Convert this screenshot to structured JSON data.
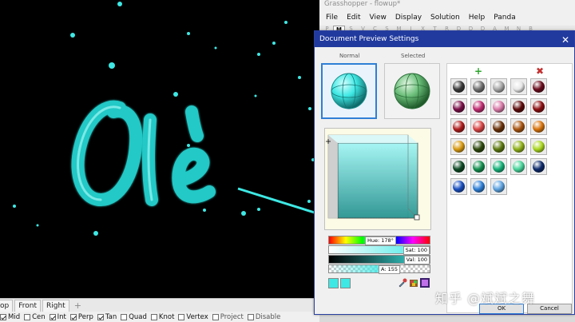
{
  "viewport": {
    "text": "Olé",
    "line_color": "#3ee8e4"
  },
  "view_tabs": {
    "items": [
      "op",
      "Front",
      "Right"
    ],
    "add": "+"
  },
  "osnap": {
    "items": [
      {
        "label": "Mid",
        "checked": true
      },
      {
        "label": "Cen",
        "checked": false
      },
      {
        "label": "Int",
        "checked": true
      },
      {
        "label": "Perp",
        "checked": true
      },
      {
        "label": "Tan",
        "checked": true
      },
      {
        "label": "Quad",
        "checked": false
      },
      {
        "label": "Knot",
        "checked": false
      },
      {
        "label": "Vertex",
        "checked": false
      },
      {
        "label": "Project",
        "checked": false
      },
      {
        "label": "Disable",
        "checked": false
      }
    ]
  },
  "grasshopper": {
    "title": "Grasshopper - flowup*",
    "menu": [
      "File",
      "Edit",
      "View",
      "Display",
      "Solution",
      "Help",
      "Panda"
    ],
    "tabs": [
      "P",
      "M",
      "S",
      "V",
      "C",
      "S",
      "M",
      "I",
      "X",
      "T",
      "R",
      "D",
      "D",
      "D",
      "A",
      "M",
      "N",
      "B"
    ]
  },
  "dialog": {
    "title": "Document Preview Settings",
    "close": "✕",
    "normal_label": "Normal",
    "selected_label": "Selected",
    "hue": "Hue: 178°",
    "sat": "Sat: 100",
    "val": "Val: 100",
    "alpha": "A: 155",
    "alpha_fraction": 0.61,
    "add_icon": "+",
    "remove_icon": "✖",
    "ok": "OK",
    "cancel": "Cancel",
    "color": "#3ee8e4",
    "swatches": [
      "#3a3a3a",
      "#707070",
      "#a6a6a6",
      "#e6e6e6",
      "#6b0d1e",
      "#7a1048",
      "#c02c72",
      "#d97aa8",
      "#5e0b0b",
      "#8c0f12",
      "#b01e1e",
      "#d84545",
      "#6b3209",
      "#a85510",
      "#d8740c",
      "#d89a12",
      "#2e4a0e",
      "#5e7a12",
      "#8fb019",
      "#a9d61e",
      "#0d4a24",
      "#159050",
      "#17b27a",
      "#48d49a",
      "#0d2a6b",
      "#1a4fbf",
      "#2f7fd6",
      "#5ea3e0"
    ]
  },
  "watermark": "知乎 @斌斌之舞"
}
